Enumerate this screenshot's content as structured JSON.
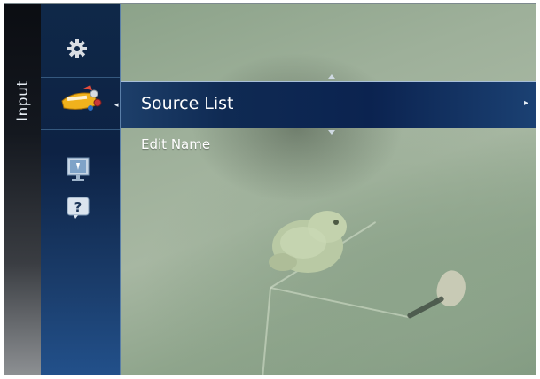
{
  "tab": {
    "label": "Input"
  },
  "icons": {
    "rail": [
      "gear-icon",
      "input-source-icon",
      "support-icon",
      "help-icon"
    ],
    "arrow_left": "◂",
    "chevron_right": "▸"
  },
  "menu": {
    "items": [
      {
        "label": "Source List",
        "selected": true
      },
      {
        "label": "Edit Name",
        "selected": false
      }
    ]
  },
  "colors": {
    "rail": "#0d2244",
    "highlight": "#0b2350",
    "accent_line": "#a8bfd9"
  }
}
